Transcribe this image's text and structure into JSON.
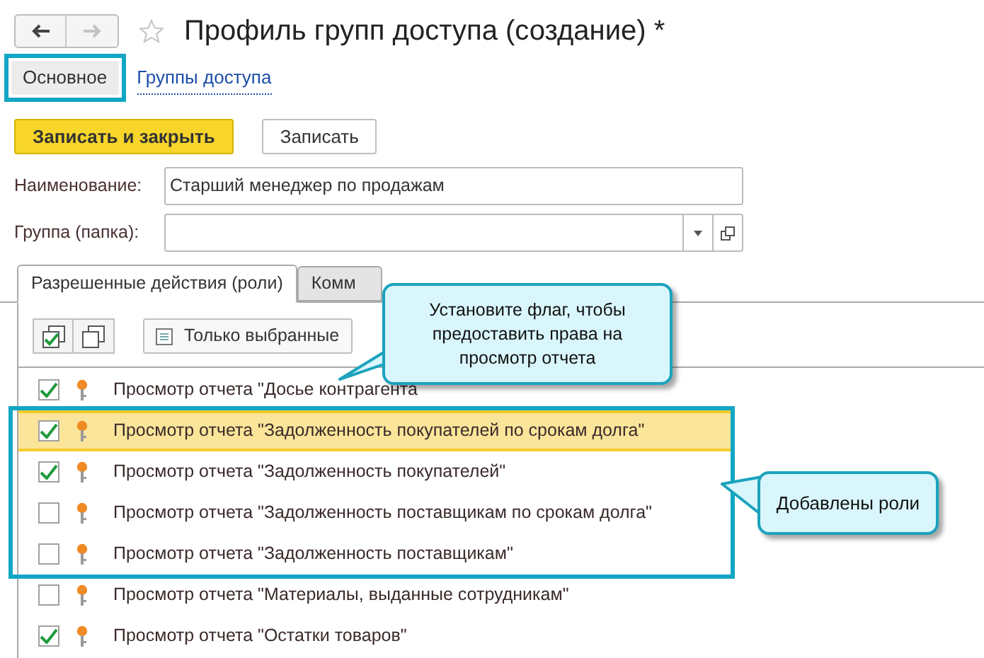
{
  "window": {
    "title": "Профиль групп доступа (создание) *",
    "favorite": false
  },
  "nav": {
    "back_disabled": false,
    "forward_disabled": true
  },
  "sections": [
    {
      "label": "Основное",
      "selected": true,
      "highlighted": true
    },
    {
      "label": "Группы доступа",
      "selected": false,
      "highlighted": false
    }
  ],
  "buttons": [
    {
      "label": "Записать и закрыть",
      "kind": "primary"
    },
    {
      "label": "Записать",
      "kind": "default"
    }
  ],
  "fields": [
    {
      "label": "Наименование:",
      "value": "Старший менеджер по продажам",
      "kind": "text"
    },
    {
      "label": "Группа (папка):",
      "kind": "choice"
    }
  ],
  "tabs": [
    {
      "label": "Разрешенные действия (роли)",
      "selected": true
    },
    {
      "label": "Комм",
      "selected": false
    }
  ],
  "toolbar": {
    "filter_button": "Только выбранные"
  },
  "roles": [
    {
      "label": "Просмотр отчета \"Досье контрагента",
      "checked": true,
      "selected": false,
      "framed": false
    },
    {
      "label": "Просмотр отчета \"Задолженность покупателей по срокам долга\"",
      "checked": true,
      "selected": true,
      "framed": true
    },
    {
      "label": "Просмотр отчета \"Задолженность покупателей\"",
      "checked": true,
      "selected": false,
      "framed": true
    },
    {
      "label": "Просмотр отчета \"Задолженность поставщикам по срокам долга\"",
      "checked": false,
      "selected": false,
      "framed": true
    },
    {
      "label": "Просмотр отчета \"Задолженность поставщикам\"",
      "checked": false,
      "selected": false,
      "framed": true
    },
    {
      "label": "Просмотр отчета \"Материалы, выданные сотрудникам\"",
      "checked": false,
      "selected": false,
      "framed": false
    },
    {
      "label": "Просмотр отчета \"Остатки товаров\"",
      "checked": true,
      "selected": false,
      "framed": false
    }
  ],
  "callouts": [
    {
      "text": "Установите флаг, чтобы предоставить права на просмотр отчета"
    },
    {
      "text": "Добавлены роли"
    }
  ]
}
